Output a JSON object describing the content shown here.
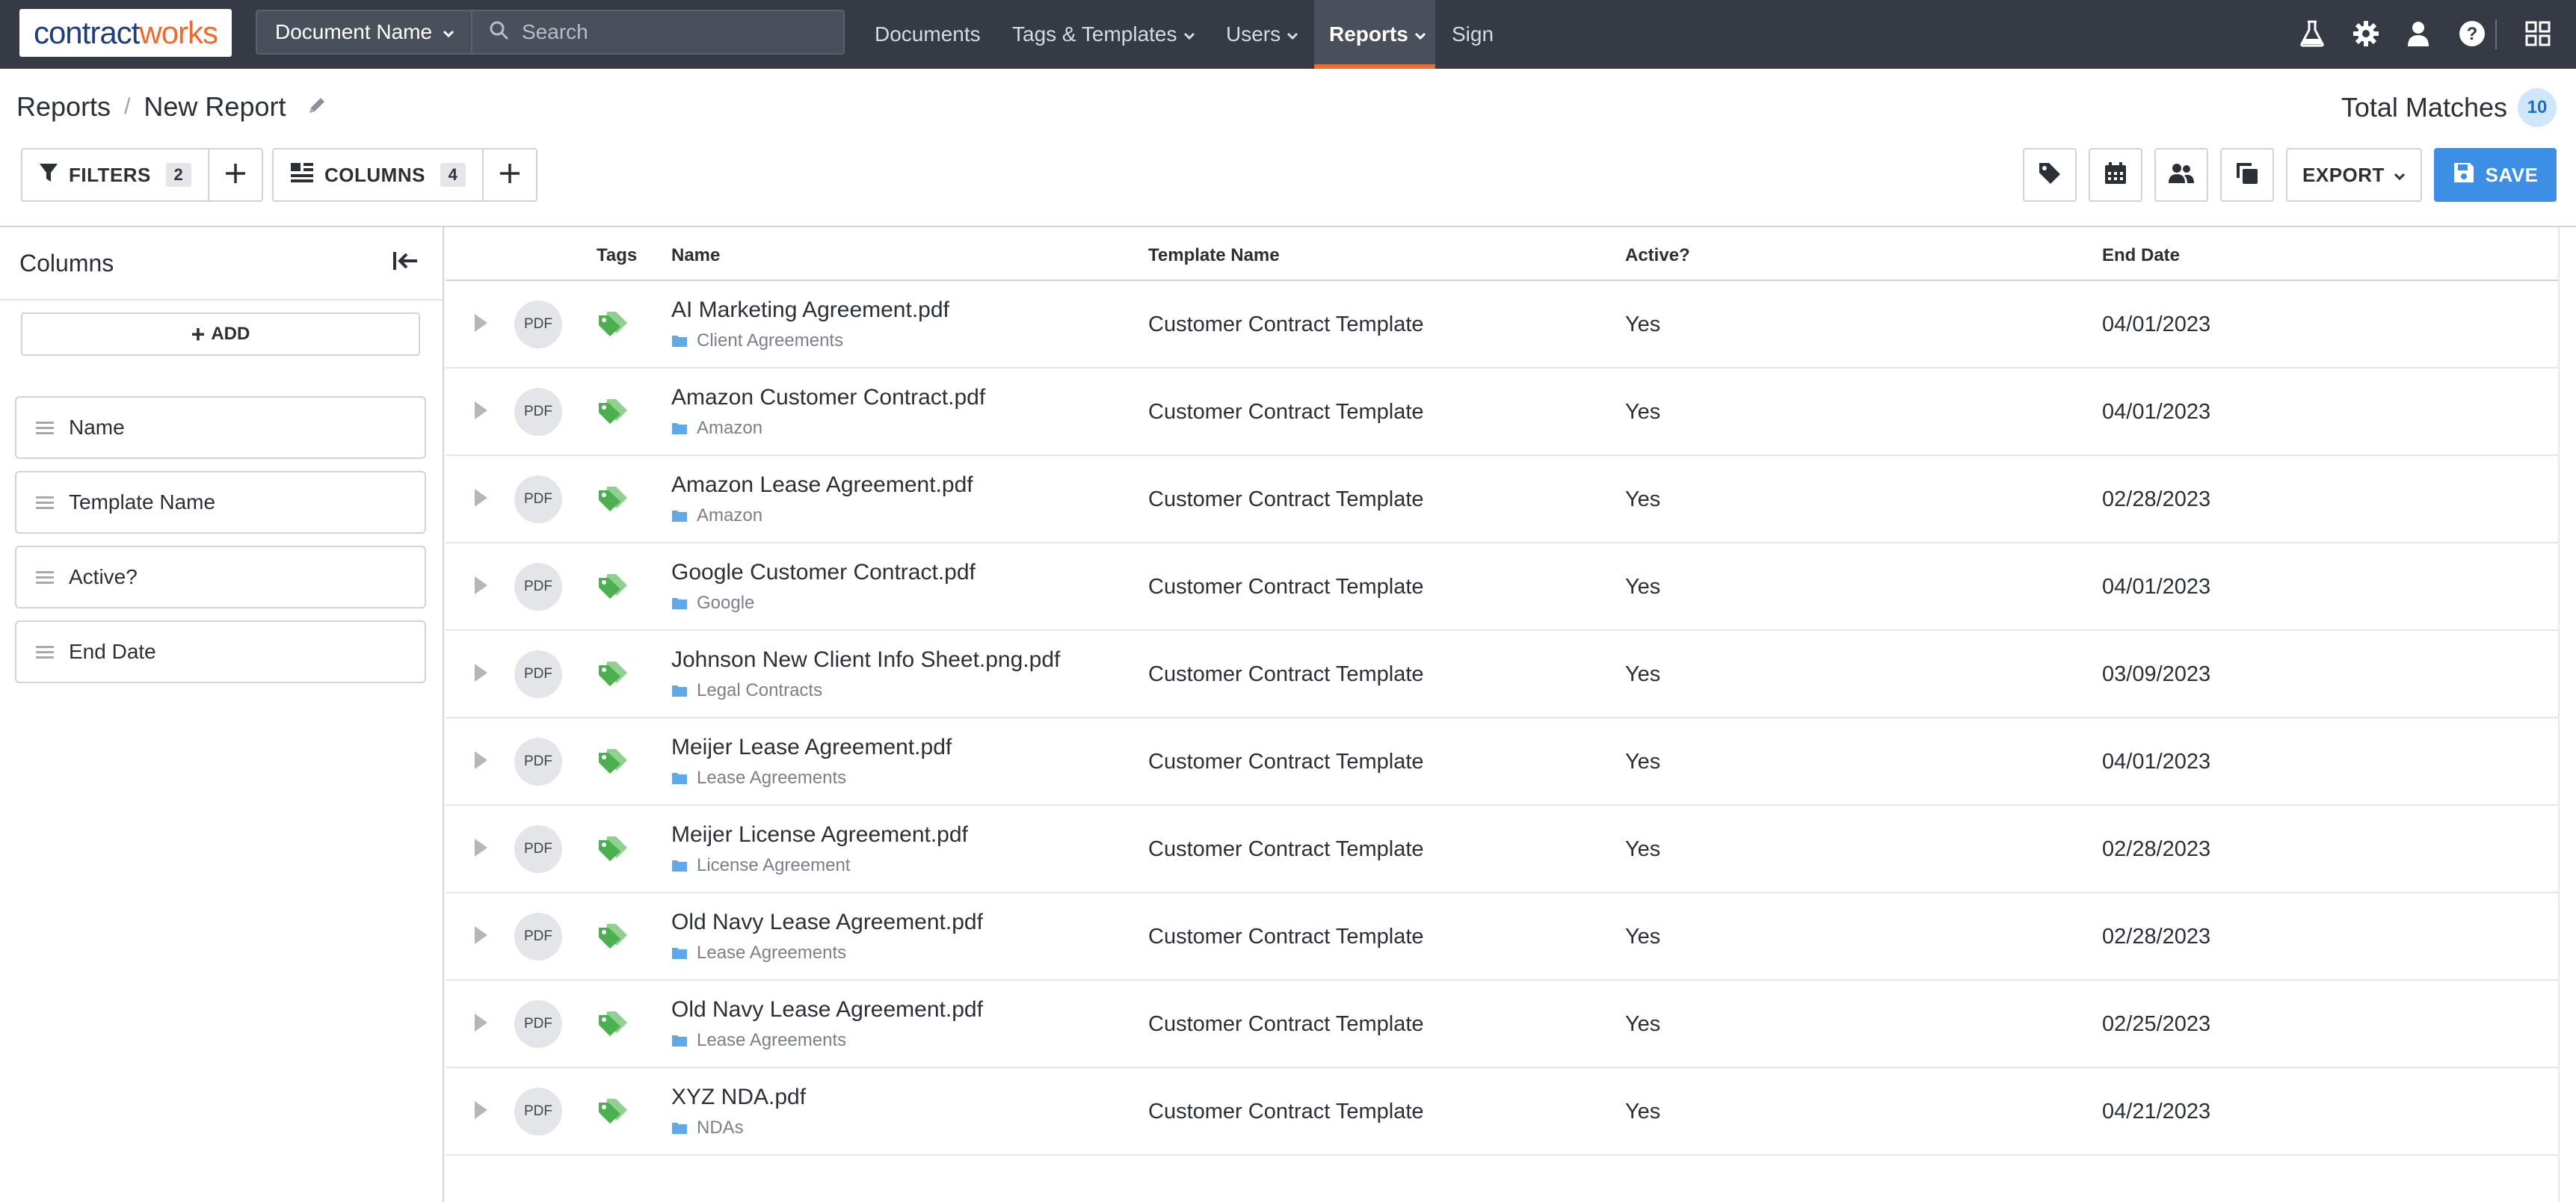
{
  "nav": {
    "logo_part1": "contract",
    "logo_part2": "works",
    "search_scope": "Document Name",
    "search_placeholder": "Search",
    "items": [
      {
        "label": "Documents"
      },
      {
        "label": "Tags & Templates"
      },
      {
        "label": "Users"
      },
      {
        "label": "Reports"
      },
      {
        "label": "Sign"
      }
    ],
    "right_icons": [
      "flask-icon",
      "gear-icon",
      "user-icon",
      "help-icon",
      "apps-grid-icon"
    ]
  },
  "header": {
    "breadcrumb_root": "Reports",
    "breadcrumb_sep": "/",
    "report_name": "New Report",
    "total_label": "Total Matches",
    "total_count": "10"
  },
  "toolbar": {
    "filters_label": "FILTERS",
    "filters_count": "2",
    "columns_label": "COLUMNS",
    "columns_count": "4",
    "export_label": "EXPORT",
    "save_label": "SAVE"
  },
  "sidebar": {
    "title": "Columns",
    "add_label": "ADD",
    "columns": [
      {
        "label": "Name"
      },
      {
        "label": "Template Name"
      },
      {
        "label": "Active?"
      },
      {
        "label": "End Date"
      }
    ]
  },
  "table": {
    "headers": {
      "tags": "Tags",
      "name": "Name",
      "template": "Template Name",
      "active": "Active?",
      "end_date": "End Date"
    },
    "file_badge": "PDF",
    "rows": [
      {
        "name": "AI Marketing Agreement.pdf",
        "folder": "Client Agreements",
        "template": "Customer Contract Template",
        "active": "Yes",
        "end_date": "04/01/2023"
      },
      {
        "name": "Amazon Customer Contract.pdf",
        "folder": "Amazon",
        "template": "Customer Contract Template",
        "active": "Yes",
        "end_date": "04/01/2023"
      },
      {
        "name": "Amazon Lease Agreement.pdf",
        "folder": "Amazon",
        "template": "Customer Contract Template",
        "active": "Yes",
        "end_date": "02/28/2023"
      },
      {
        "name": "Google Customer Contract.pdf",
        "folder": "Google",
        "template": "Customer Contract Template",
        "active": "Yes",
        "end_date": "04/01/2023"
      },
      {
        "name": "Johnson New Client Info Sheet.png.pdf",
        "folder": "Legal Contracts",
        "template": "Customer Contract Template",
        "active": "Yes",
        "end_date": "03/09/2023"
      },
      {
        "name": "Meijer Lease Agreement.pdf",
        "folder": "Lease Agreements",
        "template": "Customer Contract Template",
        "active": "Yes",
        "end_date": "04/01/2023"
      },
      {
        "name": "Meijer License Agreement.pdf",
        "folder": "License Agreement",
        "template": "Customer Contract Template",
        "active": "Yes",
        "end_date": "02/28/2023"
      },
      {
        "name": "Old Navy Lease Agreement.pdf",
        "folder": "Lease Agreements",
        "template": "Customer Contract Template",
        "active": "Yes",
        "end_date": "02/28/2023"
      },
      {
        "name": "Old Navy Lease Agreement.pdf",
        "folder": "Lease Agreements",
        "template": "Customer Contract Template",
        "active": "Yes",
        "end_date": "02/25/2023"
      },
      {
        "name": "XYZ NDA.pdf",
        "folder": "NDAs",
        "template": "Customer Contract Template",
        "active": "Yes",
        "end_date": "04/21/2023"
      }
    ]
  },
  "colors": {
    "nav_bg": "#353a44",
    "accent_orange": "#ef6b2d",
    "primary_blue": "#3d8fe6",
    "tag_green": "#4caf50",
    "folder_blue": "#5fa8ea"
  }
}
